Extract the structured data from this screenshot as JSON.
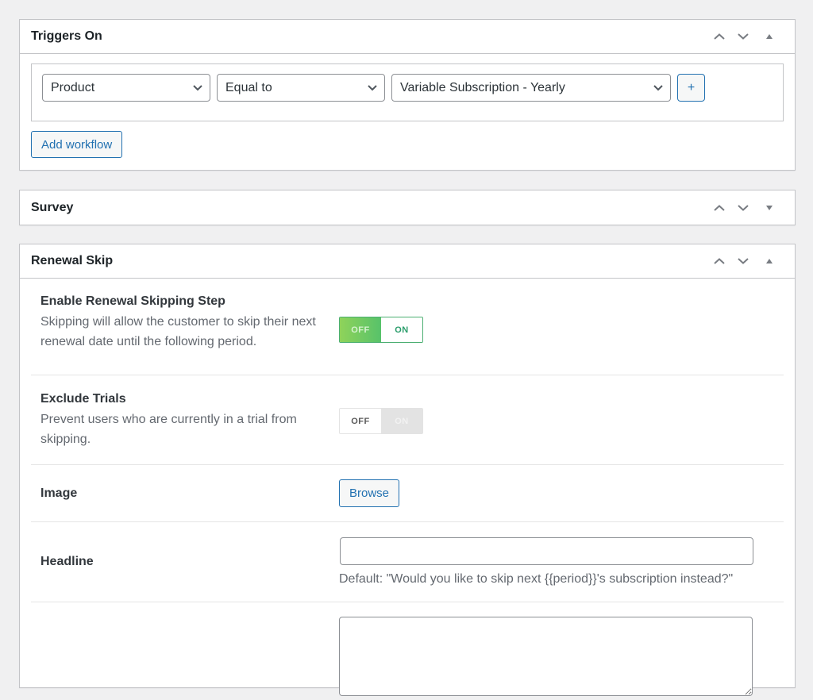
{
  "triggers": {
    "title": "Triggers On",
    "conditions": {
      "field": "Product",
      "operator": "Equal to",
      "value": "Variable Subscription - Yearly"
    },
    "add_condition_label": "+",
    "add_workflow_label": "Add workflow",
    "state": "expanded"
  },
  "survey": {
    "title": "Survey",
    "state": "collapsed"
  },
  "renewal_skip": {
    "title": "Renewal Skip",
    "state": "expanded",
    "enable": {
      "title": "Enable Renewal Skipping Step",
      "description": "Skipping will allow the customer to skip their next renewal date until the following period.",
      "off_label": "OFF",
      "on_label": "ON",
      "value": "on"
    },
    "exclude_trials": {
      "title": "Exclude Trials",
      "description": "Prevent users who are currently in a trial from skipping.",
      "off_label": "OFF",
      "on_label": "ON",
      "value": "off"
    },
    "image": {
      "title": "Image",
      "browse_label": "Browse"
    },
    "headline": {
      "title": "Headline",
      "value": "",
      "hint": "Default: \"Would you like to skip next {{period}}'s subscription instead?\""
    },
    "description_field": {
      "value": ""
    }
  },
  "icons": {
    "move_up": "chevron-up-icon",
    "move_down": "chevron-down-icon",
    "toggle_expanded": "triangle-up-icon",
    "toggle_collapsed": "triangle-down-icon",
    "select_arrow": "chevron-down-icon"
  }
}
